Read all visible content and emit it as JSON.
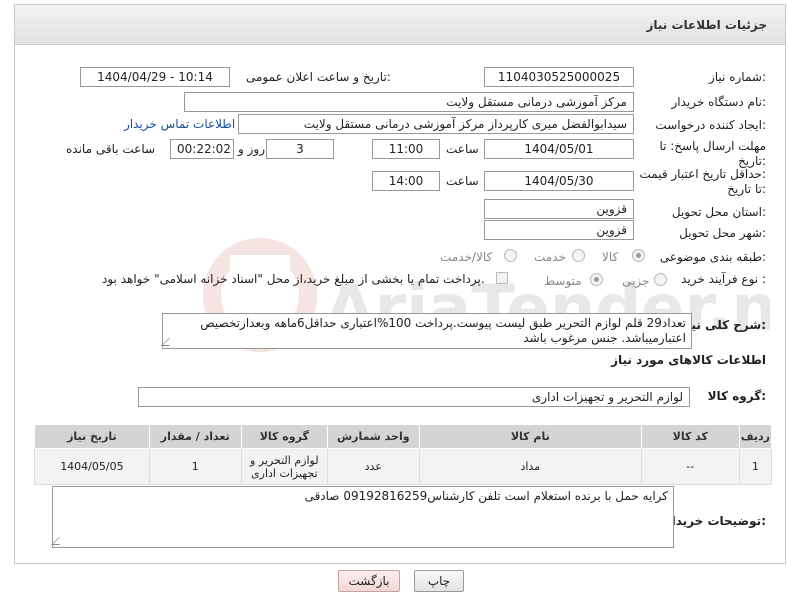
{
  "header": {
    "title": "جزئیات اطلاعات نیاز"
  },
  "fields": {
    "need_number_label": "شماره نیاز:",
    "need_number": "1104030525000025",
    "announce_label": "تاریخ و ساعت اعلان عمومی:",
    "announce_value": "1404/04/29 - 10:14",
    "buyer_org_label": "نام دستگاه خریدار:",
    "buyer_org": "مرکز آموزشی درمانی مستقل ولایت",
    "creator_label": "ایجاد کننده درخواست:",
    "creator": "سیدابوالفضل میری کارپرداز مرکز آموزشی درمانی مستقل ولایت",
    "contact_link": "اطلاعات تماس خریدار",
    "deadline_label": "مهلت ارسال پاسخ: تا تاریخ:",
    "deadline_date": "1404/05/01",
    "time_label": "ساعت",
    "deadline_time": "11:00",
    "days_value": "3",
    "days_label": "روز و",
    "remaining_time": "00:22:02",
    "remaining_label": "ساعت باقی مانده",
    "price_valid_label": "حداقل تاریخ اعتبار قیمت: تا تاریخ:",
    "price_valid_date": "1404/05/30",
    "price_valid_time": "14:00",
    "province_label": "استان محل تحویل:",
    "province": "قزوین",
    "city_label": "شهر محل تحویل:",
    "city": "قزوین",
    "category_label": "طبقه بندی موضوعی:",
    "category_options": [
      "کالا",
      "خدمت",
      "کالا/خدمت"
    ],
    "process_label": "نوع فرآیند خرید :",
    "process_options": [
      "جزیی",
      "متوسط"
    ],
    "payment_note": "پرداخت تمام یا بخشی از مبلغ خرید،از محل \"اسناد خزانه اسلامی\" خواهد بود.",
    "description_label": "شرح کلی نیاز:",
    "description": "تعداد29 قلم لوازم التحریر طبق لیست پیوست.پرداخت 100%اعتباری حداقل6ماهه وبعدازتخصیص اعتبارمیباشد. جنس مرغوب باشد"
  },
  "goods_section": {
    "title": "اطلاعات کالاهای مورد نیاز",
    "group_label": "گروه کالا:",
    "group_value": "لوازم التحریر و تجهیزات اداری"
  },
  "table": {
    "headers": [
      "ردیف",
      "کد کالا",
      "نام کالا",
      "واحد شمارش",
      "گروه کالا",
      "تعداد / مقدار",
      "تاریخ نیاز"
    ],
    "rows": [
      [
        "1",
        "--",
        "مداد",
        "عدد",
        "لوازم التحریر و تجهیزات اداری",
        "1",
        "1404/05/05"
      ]
    ]
  },
  "buyer_notes": {
    "label": "توضیحات خریدار:",
    "text": "کرایه حمل با برنده استعلام است تلفن کارشناس09192816259 صادقی"
  },
  "buttons": {
    "print": "چاپ",
    "back": "بازگشت"
  },
  "watermark": {
    "text": "AriaTender.neT"
  }
}
